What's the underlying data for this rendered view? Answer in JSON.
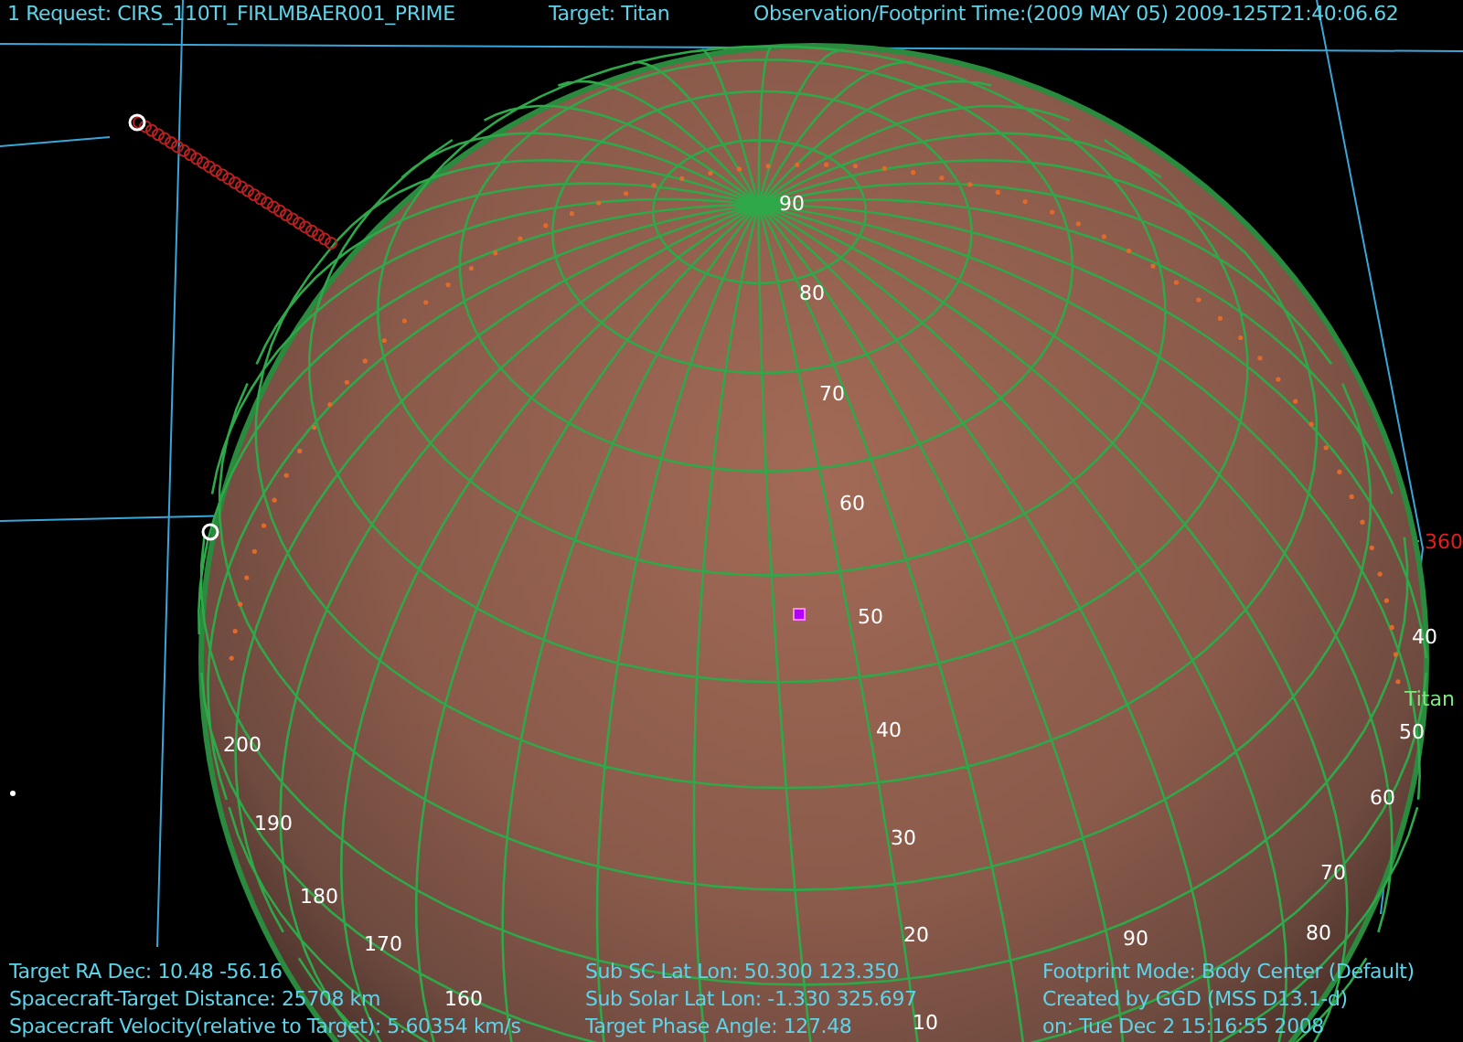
{
  "header": {
    "request": "1  Request: CIRS_110TI_FIRLMBAER001_PRIME",
    "target": "Target: Titan",
    "observation_time": "Observation/Footprint Time:(2009 MAY 05) 2009-125T21:40:06.62"
  },
  "globe": {
    "target_label": "Titan",
    "latitude_labels": [
      "90",
      "80",
      "70",
      "60",
      "50",
      "40",
      "30",
      "20",
      "10"
    ],
    "longitude_labels": [
      "200",
      "190",
      "180",
      "170",
      "160",
      "360",
      "40",
      "50",
      "60",
      "70",
      "80",
      "90"
    ]
  },
  "footer": {
    "columns": [
      [
        "Target RA Dec: 10.48  -56.16",
        "Spacecraft-Target Distance:   25708 km",
        "Spacecraft Velocity(relative to Target): 5.60354 km/s"
      ],
      [
        "Sub SC Lat Lon: 50.300  123.350",
        "Sub Solar Lat Lon: -1.330  325.697",
        "Target Phase Angle: 127.48"
      ],
      [
        "Footprint Mode: Body Center (Default)",
        "Created by GGD (MSS D13.1-d)",
        "on: Tue Dec  2 15:16:55 2008"
      ]
    ]
  }
}
